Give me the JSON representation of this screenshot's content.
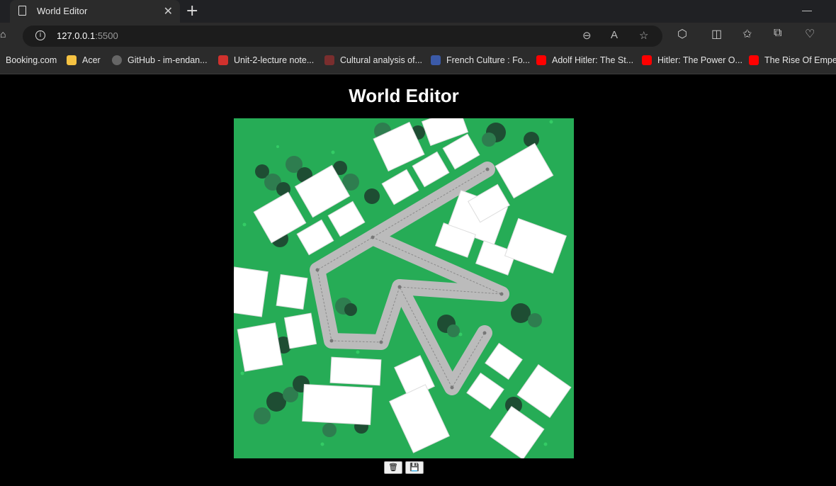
{
  "browser": {
    "tab_title": "World Editor",
    "new_tab_icon": "plus-icon",
    "url_host": "127.0.0.1",
    "url_port": ":5500",
    "bookmarks": [
      {
        "label": "Booking.com",
        "icon": "booking-icon",
        "color": "#2b2b2b"
      },
      {
        "label": "Acer",
        "icon": "folder-icon",
        "color": "#f5c242"
      },
      {
        "label": "GitHub - im-endan...",
        "icon": "github-icon",
        "color": "#555555"
      },
      {
        "label": "Unit-2-lecture note...",
        "icon": "pdf-icon",
        "color": "#d0312d"
      },
      {
        "label": "Cultural analysis of...",
        "icon": "chart-icon",
        "color": "#7a2e2e"
      },
      {
        "label": "French Culture : Fo...",
        "icon": "site-icon",
        "color": "#3b5aa8"
      },
      {
        "label": "Adolf Hitler: The St...",
        "icon": "youtube-icon",
        "color": "#ff0000"
      },
      {
        "label": "Hitler: The Power O...",
        "icon": "youtube-icon",
        "color": "#ff0000"
      },
      {
        "label": "The Rise Of Empere",
        "icon": "youtube-icon",
        "color": "#ff0000"
      }
    ]
  },
  "page": {
    "title": "World Editor"
  },
  "controls": {
    "dispose_icon": "trash-icon",
    "save_icon": "save-icon"
  },
  "colors": {
    "grass": "#26ac56",
    "road": "#bbbbbb",
    "building": "#ffffff",
    "tree_dark": "#1e4d33",
    "tree_mid": "#2e7d4f"
  }
}
